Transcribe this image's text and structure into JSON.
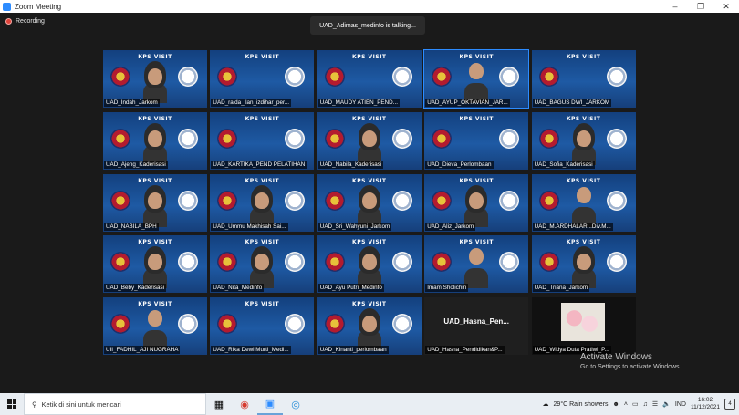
{
  "window": {
    "title": "Zoom Meeting"
  },
  "recording_label": "Recording",
  "talking_indicator": "UAD_Adimas_medinfo is talking...",
  "banner_text": "KPS VISIT",
  "participants": [
    {
      "name": "UAD_Indah_Jarkom",
      "style": "hijab"
    },
    {
      "name": "UAD_raida_ilan_izdihar_per...",
      "style": "none"
    },
    {
      "name": "UAD_MAUDY ATIEN_PEND...",
      "style": "none"
    },
    {
      "name": "UAD_AYUP_OKTAVIAN_JAR...",
      "style": "person",
      "active": true
    },
    {
      "name": "UAD_BAGUS DWI_JARKOM",
      "style": "none"
    },
    {
      "name": "UAD_Ajeng_Kaderisasi",
      "style": "hijab"
    },
    {
      "name": "UAD_KARTIKA_PEND PELATIHAN",
      "style": "none"
    },
    {
      "name": "UAD_Nabila_Kaderisasi",
      "style": "hijab"
    },
    {
      "name": "UAD_Dieva_Perlombaan",
      "style": "none"
    },
    {
      "name": "UAD_Sofia_Kaderisasi",
      "style": "hijab"
    },
    {
      "name": "UAD_NABILA_BPH",
      "style": "hijab"
    },
    {
      "name": "UAD_Ummu Makhisah Sai...",
      "style": "hijab"
    },
    {
      "name": "UAD_Sri_Wahyuni_Jarkom",
      "style": "hijab"
    },
    {
      "name": "UAD_Aliz_Jarkom",
      "style": "hijab"
    },
    {
      "name": "UAD_M.ARDHALAR...Div.M...",
      "style": "person"
    },
    {
      "name": "UAD_Beby_Kaderisasi",
      "style": "hijab"
    },
    {
      "name": "UAD_Nita_Medinfo",
      "style": "hijab"
    },
    {
      "name": "UAD_Ayu Putri_Medinfo",
      "style": "hijab"
    },
    {
      "name": "Imam Sholichin",
      "style": "person"
    },
    {
      "name": "UAD_Triana_Jarkom",
      "style": "hijab"
    },
    {
      "name": "UII_FADHIL_AJI NUGRAHA",
      "style": "person"
    },
    {
      "name": "UAD_Rika Dewi Murti_Medi...",
      "style": "none"
    },
    {
      "name": "UAD_Kinanti_perlombaan",
      "style": "hijab"
    },
    {
      "name": "UAD_Hasna_Pendidikan&P...",
      "style": "off",
      "bigname": "UAD_Hasna_Pen..."
    },
    {
      "name": "UAD_Widya Duta Pratiwi_P...",
      "style": "flowers"
    }
  ],
  "watermark": {
    "line1": "Activate Windows",
    "line2": "Go to Settings to activate Windows."
  },
  "taskbar": {
    "search_placeholder": "Ketik di sini untuk mencari",
    "weather": "29°C  Rain showers",
    "language": "IND",
    "time": "16:02",
    "date": "11/12/2021",
    "notification_count": "4"
  }
}
